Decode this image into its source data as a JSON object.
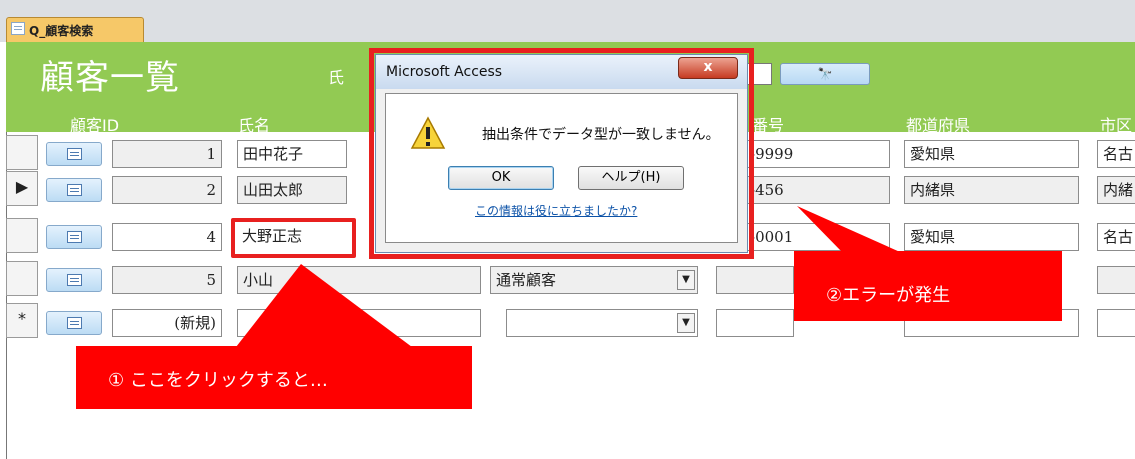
{
  "tab": {
    "label": "Q_顧客検索"
  },
  "form": {
    "title": "顧客一覧",
    "search_label": "氏",
    "search_button_label": "🔭"
  },
  "columns": {
    "id": "顧客ID",
    "name": "氏名",
    "postal_partial": "番号",
    "pref": "都道府県",
    "city_partial": "市区"
  },
  "rows": [
    {
      "selector": "",
      "id": "1",
      "name": "田中花子",
      "postal": "-9999",
      "pref": "愛知県",
      "city": "名古"
    },
    {
      "selector": "▶",
      "id": "2",
      "name": "山田太郎",
      "postal": "-456",
      "pref": "内緒県",
      "city": "内緒"
    },
    {
      "selector": "",
      "id": "4",
      "name": "大野正志",
      "postal": "-0001",
      "pref": "愛知県",
      "city": "名古"
    },
    {
      "selector": "",
      "id": "5",
      "name": "小山",
      "type": "通常顧客",
      "postal": "",
      "pref": "",
      "city": ""
    },
    {
      "selector": "*",
      "id": "(新規)",
      "name": "",
      "type": "",
      "postal": "",
      "pref": "",
      "city": ""
    }
  ],
  "dialog": {
    "title": "Microsoft Access",
    "close_label": "x",
    "message": "抽出条件でデータ型が一致しません。",
    "ok_label": "OK",
    "help_label": "ヘルプ(H)",
    "link_text": "この情報は役に立ちましたか?"
  },
  "callouts": {
    "first": "① ここをクリックすると…",
    "second": "②エラーが発生"
  },
  "colors": {
    "header_green": "#92ca53",
    "callout_red": "#ff0000",
    "highlight_red": "#e8201f"
  },
  "icons": {
    "search_button": "binoculars-icon",
    "warning": "warning-triangle-icon",
    "row_button": "form-view-icon"
  }
}
